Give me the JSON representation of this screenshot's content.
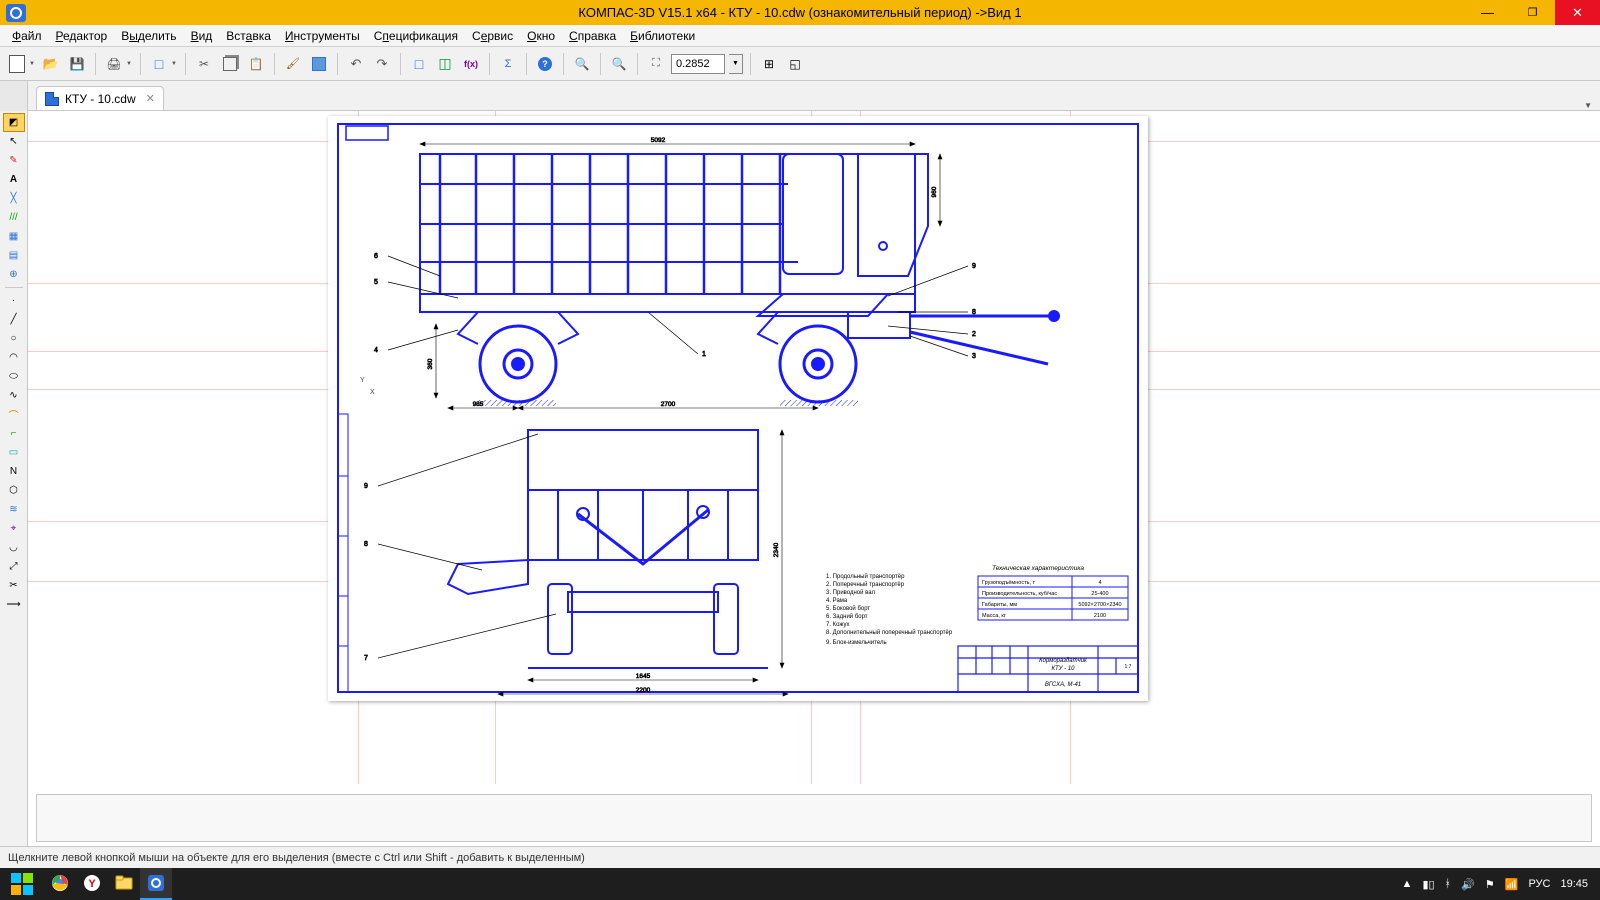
{
  "title": "КОМПАС-3D V15.1 x64 - КТУ - 10.cdw (ознакомительный период) ->Вид 1",
  "menu": [
    "Файл",
    "Редактор",
    "Выделить",
    "Вид",
    "Вставка",
    "Инструменты",
    "Спецификация",
    "Сервис",
    "Окно",
    "Справка",
    "Библиотеки"
  ],
  "zoom_value": "0.2852",
  "tab": {
    "label": "КТУ - 10.cdw"
  },
  "status": "Щелкните левой кнопкой мыши на объекте для его выделения (вместе с Ctrl или Shift - добавить к выделенным)",
  "tray": {
    "lang": "РУС",
    "time": "19:45"
  },
  "drawing": {
    "dim_top": "5092",
    "dim_gap": "985",
    "dim_wb": "2700",
    "dim_front_width": "2200",
    "dim_front_width2": "1645",
    "dim_height": "2340",
    "dim_side_h": "960",
    "dim_side_h2": "360",
    "callouts": [
      "1",
      "2",
      "3",
      "4",
      "5",
      "6",
      "7",
      "8",
      "9"
    ],
    "char_title": "Техническая характеристика",
    "char_rows": [
      [
        "Грузоподъёмность, т",
        "4"
      ],
      [
        "Производительность, куб/час",
        "25-400"
      ],
      [
        "Габариты, мм",
        "5092×2700×2340"
      ],
      [
        "Масса, кг",
        "2100"
      ]
    ],
    "legend_title": "",
    "legend": [
      "1. Продольный транспортёр",
      "2. Поперечный транспортёр",
      "3. Приводной вал",
      "4. Рама",
      "5. Боковой борт",
      "6. Задний борт",
      "7. Кожух",
      "8. Дополнительный поперечный транспортёр",
      "9. Блок-измельчитель"
    ],
    "stamp_name": "Кормораздатчик\nКТУ - 10",
    "stamp_org": "ВГСХА, М-41"
  }
}
